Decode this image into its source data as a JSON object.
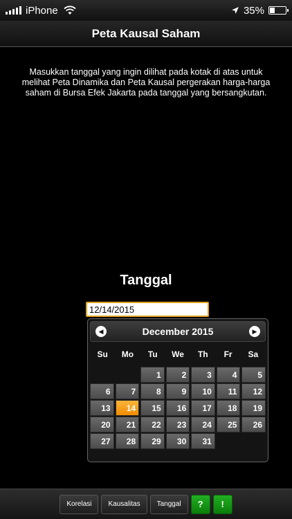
{
  "status_bar": {
    "carrier": "iPhone",
    "battery_text": "35%",
    "battery_level": 0.35
  },
  "title": "Peta Kausal Saham",
  "intro_text": "Masukkan tanggal yang ingin dilihat pada kotak di atas untuk melihat Peta Dinamika dan Peta Kausal pergerakan harga-harga saham di Bursa Efek Jakarta pada tanggal yang bersangkutan.",
  "date_label": "Tanggal",
  "date_input": {
    "value": "12/14/2015"
  },
  "calendar": {
    "month_title": "December 2015",
    "prev_icon": "chevron-left-icon",
    "next_icon": "chevron-right-icon",
    "weekdays": [
      "Su",
      "Mo",
      "Tu",
      "We",
      "Th",
      "Fr",
      "Sa"
    ],
    "leading_blanks": 2,
    "days": [
      "1",
      "2",
      "3",
      "4",
      "5",
      "6",
      "7",
      "8",
      "9",
      "10",
      "11",
      "12",
      "13",
      "14",
      "15",
      "16",
      "17",
      "18",
      "19",
      "20",
      "21",
      "22",
      "23",
      "24",
      "25",
      "26",
      "27",
      "28",
      "29",
      "30",
      "31"
    ],
    "selected_day": "14"
  },
  "footer": {
    "korelasi": "Korelasi",
    "kausalitas": "Kausalitas",
    "tanggal": "Tanggal",
    "help": "?",
    "info": "!"
  },
  "colors": {
    "accent": "#f39a12",
    "green": "#1a9d1a"
  }
}
